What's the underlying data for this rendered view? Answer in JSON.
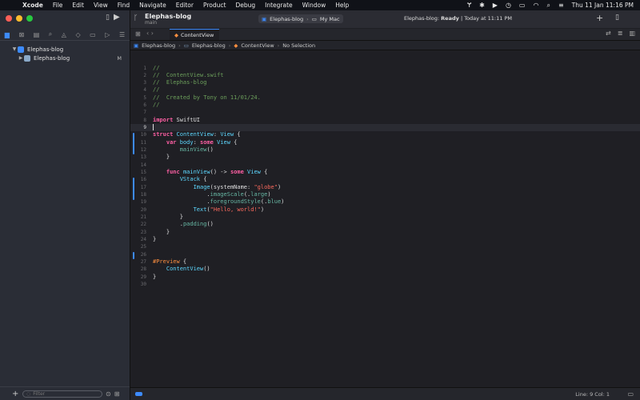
{
  "menubar": {
    "items": [
      "Xcode",
      "File",
      "Edit",
      "View",
      "Find",
      "Navigate",
      "Editor",
      "Product",
      "Debug",
      "Integrate",
      "Window",
      "Help"
    ],
    "clock": "Thu 11 Jan  11:16 PM"
  },
  "window": {
    "project_title": "Elephas-blog",
    "branch": "main",
    "scheme_target": "Elephas-blog",
    "scheme_device": "My Mac",
    "status_prefix": "Elephas-blog: ",
    "status_ready": "Ready",
    "status_time": " | Today at 11:11 PM"
  },
  "sidebar": {
    "project": "Elephas-blog",
    "folder": "Elephas-blog",
    "folder_badge": "M",
    "filter_placeholder": "Filter"
  },
  "tab": {
    "label": "ContentView"
  },
  "jumpbar": [
    "Elephas-blog",
    "Elephas-blog",
    "ContentView.swift",
    "ContentView",
    "No Selection"
  ],
  "jumpbar_display": [
    "Elephas-blog",
    "Elephas-blog",
    "ContentView",
    "No Selection"
  ],
  "editor": {
    "current_line": 9,
    "lines": [
      "1",
      "2",
      "3",
      "4",
      "5",
      "6",
      "7",
      "8",
      "9",
      "10",
      "11",
      "12",
      "13",
      "14",
      "15",
      "16",
      "17",
      "18",
      "19",
      "20",
      "21",
      "22",
      "23",
      "24",
      "25",
      "26",
      "27",
      "28",
      "29",
      "30"
    ]
  },
  "statusbar": {
    "position": "Line: 9  Col: 1"
  }
}
